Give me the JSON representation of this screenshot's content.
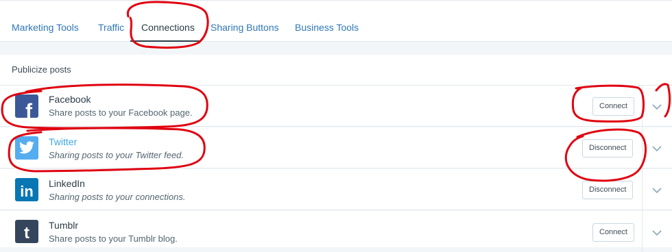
{
  "tabs": [
    {
      "label": "Marketing Tools",
      "active": false
    },
    {
      "label": "Traffic",
      "active": false
    },
    {
      "label": "Connections",
      "active": true
    },
    {
      "label": "Sharing Buttons",
      "active": false
    },
    {
      "label": "Business Tools",
      "active": false
    }
  ],
  "section": {
    "title": "Publicize posts"
  },
  "services": [
    {
      "name": "Facebook",
      "description": "Share posts to your Facebook page.",
      "button": "Connect",
      "icon": "facebook-icon",
      "color": "#3b5998"
    },
    {
      "name": "Twitter",
      "description": "Sharing posts to your Twitter feed.",
      "button": "Disconnect",
      "icon": "twitter-icon",
      "color": "#55acee"
    },
    {
      "name": "LinkedIn",
      "description": "Sharing posts to your connections.",
      "button": "Disconnect",
      "icon": "linkedin-icon",
      "color": "#0976b4"
    },
    {
      "name": "Tumblr",
      "description": "Share posts to your Tumblr blog.",
      "button": "Connect",
      "icon": "tumblr-icon",
      "color": "#35465c"
    }
  ],
  "annotation_color": "#e0000f"
}
